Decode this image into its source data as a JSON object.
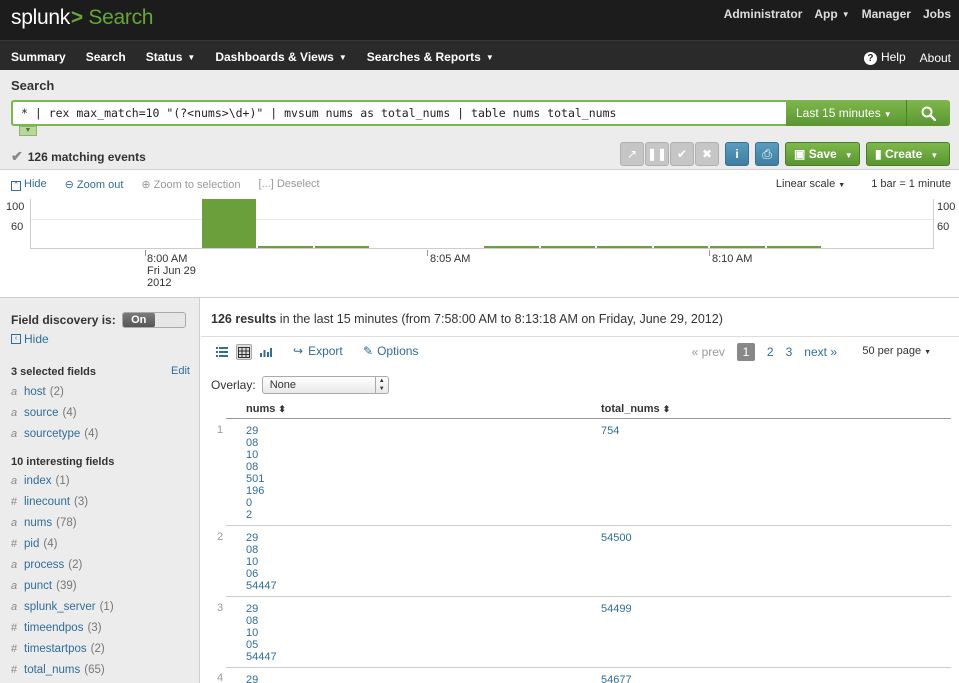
{
  "header": {
    "logo": "splunk",
    "logo_sep": ">",
    "app_name": "Search",
    "topnav": [
      "Administrator",
      "App",
      "Manager",
      "Jobs"
    ]
  },
  "nav": {
    "left": [
      "Summary",
      "Search",
      "Status",
      "Dashboards & Views",
      "Searches & Reports"
    ],
    "right": [
      "Help",
      "About"
    ]
  },
  "search": {
    "title": "Search",
    "query": "* | rex max_match=10 \"(?<nums>\\d+)\" | mvsum nums as total_nums | table nums total_nums",
    "time_range": "Last 15 minutes",
    "status": "126 matching events",
    "save_label": "Save",
    "create_label": "Create"
  },
  "timeline": {
    "hide": "Hide",
    "zoom_out": "Zoom out",
    "zoom_sel": "Zoom to selection",
    "deselect": "[...] Deselect",
    "scale": "Linear scale",
    "bar_unit": "1 bar = 1 minute",
    "y_ticks": [
      "100",
      "60"
    ],
    "x_labels": [
      {
        "l1": "8:00 AM",
        "l2": "Fri Jun 29",
        "l3": "2012"
      },
      {
        "l1": "8:05 AM",
        "l2": "",
        "l3": ""
      },
      {
        "l1": "8:10 AM",
        "l2": "",
        "l3": ""
      }
    ],
    "counts": [
      0,
      0,
      0,
      101,
      2,
      2,
      0,
      0,
      1,
      2,
      1,
      4,
      4,
      2,
      0,
      0
    ],
    "ymax": 100,
    "color": "#6a9f3c"
  },
  "sidebar": {
    "field_discovery": "Field discovery is:",
    "toggle": "On",
    "hide": "Hide",
    "selected_title": "3 selected fields",
    "edit": "Edit",
    "selected": [
      {
        "type": "a",
        "name": "host",
        "count": "(2)"
      },
      {
        "type": "a",
        "name": "source",
        "count": "(4)"
      },
      {
        "type": "a",
        "name": "sourcetype",
        "count": "(4)"
      }
    ],
    "interesting_title": "10 interesting fields",
    "interesting": [
      {
        "type": "a",
        "name": "index",
        "count": "(1)"
      },
      {
        "type": "#",
        "name": "linecount",
        "count": "(3)"
      },
      {
        "type": "a",
        "name": "nums",
        "count": "(78)"
      },
      {
        "type": "#",
        "name": "pid",
        "count": "(4)"
      },
      {
        "type": "a",
        "name": "process",
        "count": "(2)"
      },
      {
        "type": "a",
        "name": "punct",
        "count": "(39)"
      },
      {
        "type": "a",
        "name": "splunk_server",
        "count": "(1)"
      },
      {
        "type": "#",
        "name": "timeendpos",
        "count": "(3)"
      },
      {
        "type": "#",
        "name": "timestartpos",
        "count": "(2)"
      },
      {
        "type": "#",
        "name": "total_nums",
        "count": "(65)"
      }
    ]
  },
  "results": {
    "count": "126 results",
    "summary_rest": " in the last 15 minutes (from 7:58:00 AM to 8:13:18 AM on Friday, June 29, 2012)",
    "export": "Export",
    "options": "Options",
    "prev": "« prev",
    "pages": [
      "1",
      "2",
      "3"
    ],
    "next": "next »",
    "per_page": "50 per page",
    "overlay_label": "Overlay:",
    "overlay_value": "None",
    "columns": [
      "nums",
      "total_nums"
    ],
    "rows": [
      {
        "num": "1",
        "nums": [
          "29",
          "08",
          "10",
          "08",
          "501",
          "196",
          "0",
          "2"
        ],
        "total": "754"
      },
      {
        "num": "2",
        "nums": [
          "29",
          "08",
          "10",
          "06",
          "54447"
        ],
        "total": "54500"
      },
      {
        "num": "3",
        "nums": [
          "29",
          "08",
          "10",
          "05",
          "54447"
        ],
        "total": "54499"
      },
      {
        "num": "4",
        "nums": [
          "29"
        ],
        "total": "54677"
      }
    ]
  }
}
